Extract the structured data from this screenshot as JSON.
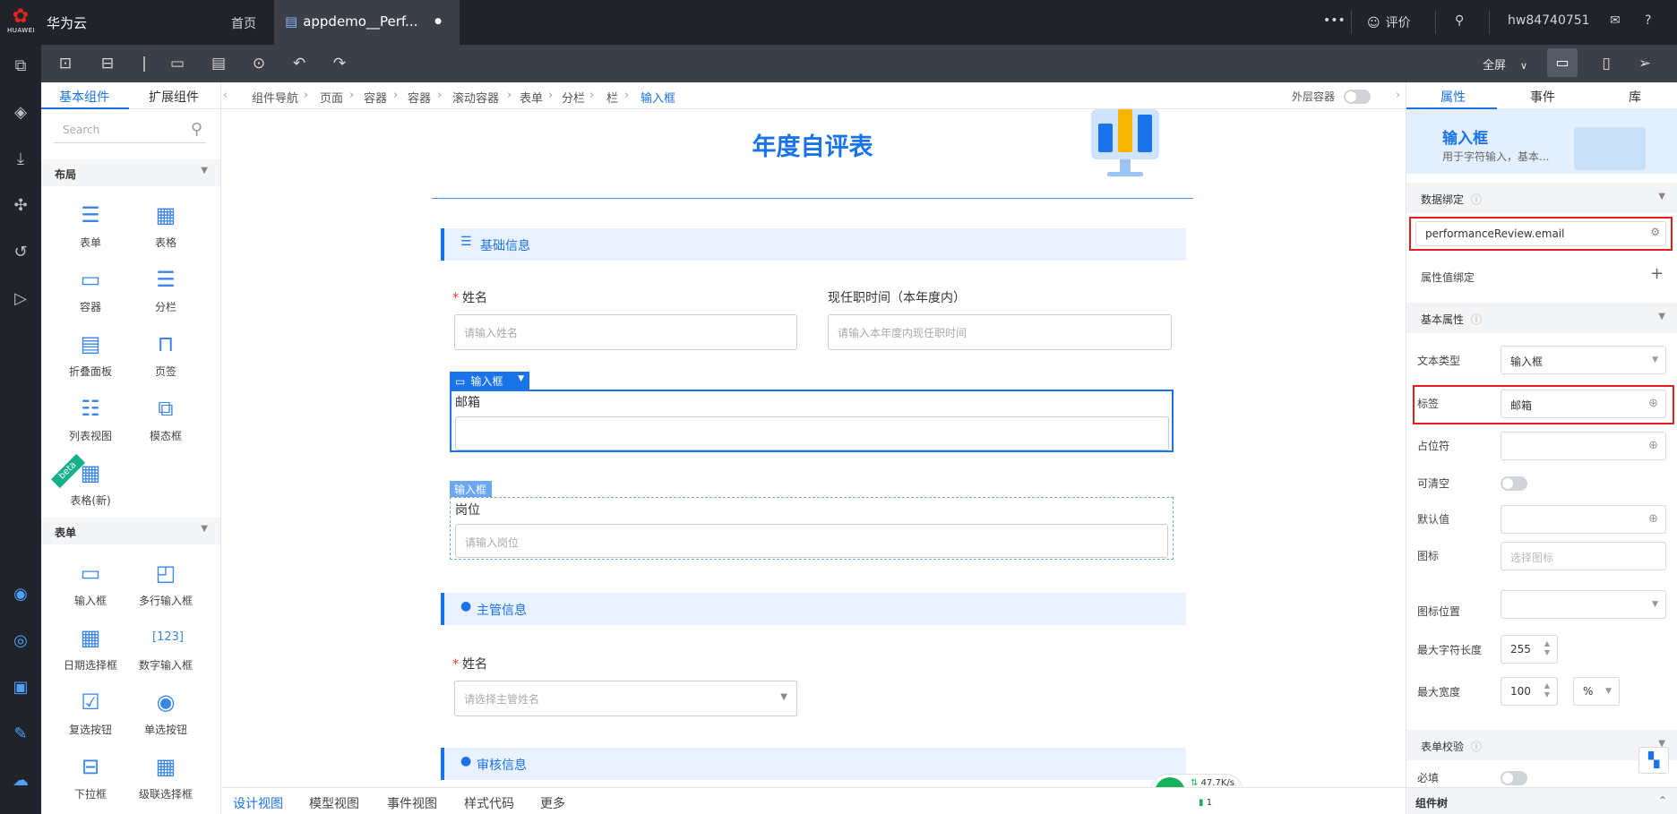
{
  "topbar": {
    "logo_text": "HUAWEI",
    "brand": "华为云",
    "home": "首页",
    "doc_tab": "appdemo__Perf...",
    "doc_dot": "●",
    "more": "•••",
    "rate": "评价",
    "user": "hw84740751"
  },
  "toolbar": {
    "fullscreen": "全屏"
  },
  "components": {
    "tabs": [
      "基本组件",
      "扩展组件"
    ],
    "search_placeholder": "Search",
    "groups": [
      "布局",
      "表单"
    ],
    "layout_items": [
      "表单",
      "表格",
      "容器",
      "分栏",
      "折叠面板",
      "页签",
      "列表视图",
      "模态框",
      "表格(新)"
    ],
    "form_items": [
      "输入框",
      "多行输入框",
      "日期选择框",
      "数字输入框",
      "复选按钮",
      "单选按钮",
      "下拉框",
      "级联选择框"
    ],
    "beta": "beta"
  },
  "breadcrumb": {
    "items": [
      "组件导航",
      "页面",
      "容器",
      "容器",
      "滚动容器",
      "表单",
      "分栏",
      "栏",
      "输入框"
    ],
    "outer_container": "外层容器"
  },
  "canvas": {
    "title": "年度自评表",
    "section1": "基础信息",
    "name_label": "姓名",
    "name_placeholder": "请输入姓名",
    "tenure_label": "现任职时间（本年度内）",
    "tenure_placeholder": "请输入本年度内现任职时间",
    "selected_tag": "输入框",
    "email_label": "邮箱",
    "hover_tag": "输入框",
    "post_label": "岗位",
    "post_placeholder": "请输入岗位",
    "section2": "主管信息",
    "manager_label": "姓名",
    "manager_placeholder": "请选择主管姓名",
    "section3": "审核信息"
  },
  "network": {
    "speed": "47.7K/s",
    "count": "1"
  },
  "bottom_tabs": [
    "设计视图",
    "模型视图",
    "事件视图",
    "样式代码",
    "更多"
  ],
  "props": {
    "tabs": [
      "属性",
      "事件",
      "库"
    ],
    "title": "输入框",
    "desc": "用于字符输入，基本...",
    "data_binding": "数据绑定",
    "binding_value": "performanceReview.email",
    "attr_binding": "属性值绑定",
    "basic_props": "基本属性",
    "text_type_label": "文本类型",
    "text_type_value": "输入框",
    "label_label": "标签",
    "label_value": "邮箱",
    "placeholder_label": "占位符",
    "clearable_label": "可清空",
    "default_label": "默认值",
    "icon_label": "图标",
    "icon_placeholder": "选择图标",
    "icon_pos_label": "图标位置",
    "maxlen_label": "最大字符长度",
    "maxlen_value": "255",
    "maxwidth_label": "最大宽度",
    "maxwidth_value": "100",
    "maxwidth_unit": "%",
    "validation": "表单校验",
    "required_label": "必填",
    "tree": "组件树"
  }
}
